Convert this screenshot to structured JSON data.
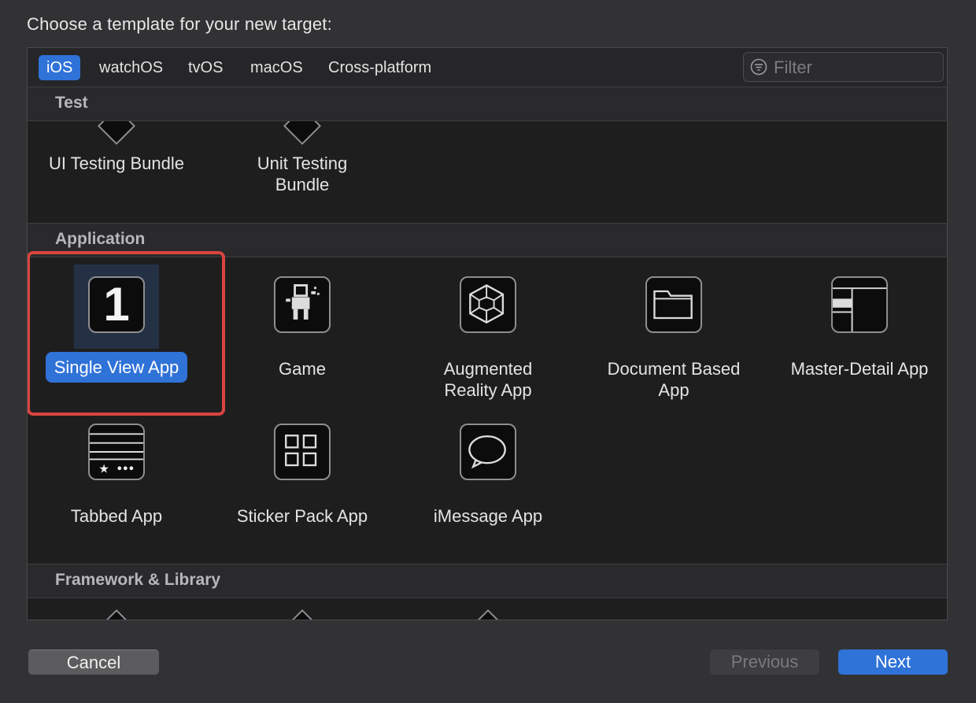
{
  "prompt": "Choose a template for your new target:",
  "tabs": [
    {
      "label": "iOS",
      "active": true
    },
    {
      "label": "watchOS",
      "active": false
    },
    {
      "label": "tvOS",
      "active": false
    },
    {
      "label": "macOS",
      "active": false
    },
    {
      "label": "Cross-platform",
      "active": false
    }
  ],
  "filter": {
    "placeholder": "Filter",
    "value": ""
  },
  "sections": {
    "test": {
      "title": "Test",
      "items": [
        {
          "label_line1": "UI Testing Bundle",
          "label_line2": ""
        },
        {
          "label_line1": "Unit Testing",
          "label_line2": "Bundle"
        }
      ]
    },
    "application": {
      "title": "Application",
      "items": [
        {
          "label_line1": "Single View App",
          "label_line2": "",
          "selected": true,
          "icon": "single-view-icon",
          "glyph": "1"
        },
        {
          "label_line1": "Game",
          "label_line2": "",
          "icon": "game-icon"
        },
        {
          "label_line1": "Augmented",
          "label_line2": "Reality App",
          "icon": "ar-cube-icon"
        },
        {
          "label_line1": "Document Based",
          "label_line2": "App",
          "icon": "folder-icon"
        },
        {
          "label_line1": "Master-Detail App",
          "label_line2": "",
          "icon": "master-detail-icon"
        },
        {
          "label_line1": "Tabbed App",
          "label_line2": "",
          "icon": "tabbed-icon"
        },
        {
          "label_line1": "Sticker Pack App",
          "label_line2": "",
          "icon": "sticker-grid-icon"
        },
        {
          "label_line1": "iMessage App",
          "label_line2": "",
          "icon": "message-bubble-icon"
        }
      ]
    },
    "framework": {
      "title": "Framework & Library"
    }
  },
  "buttons": {
    "cancel": "Cancel",
    "previous": "Previous",
    "next": "Next"
  },
  "colors": {
    "accent": "#2f72d8",
    "highlight": "#d9443f",
    "background": "#323234"
  }
}
